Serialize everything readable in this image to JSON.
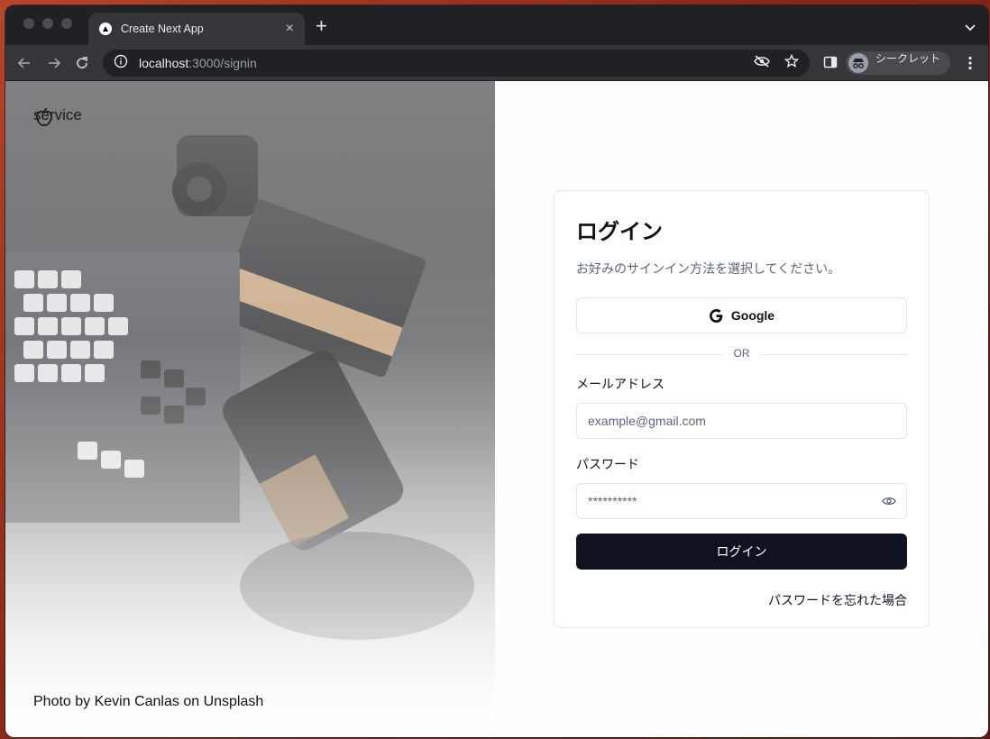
{
  "browser": {
    "tab_title": "Create Next App",
    "tab_close": "×",
    "new_tab": "+",
    "url_host": "localhost",
    "url_path": ":3000/signin",
    "profile_label": "シークレット"
  },
  "hero": {
    "brand_name": "service",
    "photo_credit": "Photo by Kevin Canlas on Unsplash"
  },
  "login": {
    "title": "ログイン",
    "description": "お好みのサインイン方法を選択してください。",
    "google_button": "Google",
    "divider": "OR",
    "email_label": "メールアドレス",
    "email_placeholder": "example@gmail.com",
    "password_label": "パスワード",
    "password_value": "**********",
    "submit_button": "ログイン",
    "forgot_link": "パスワードを忘れた場合"
  }
}
